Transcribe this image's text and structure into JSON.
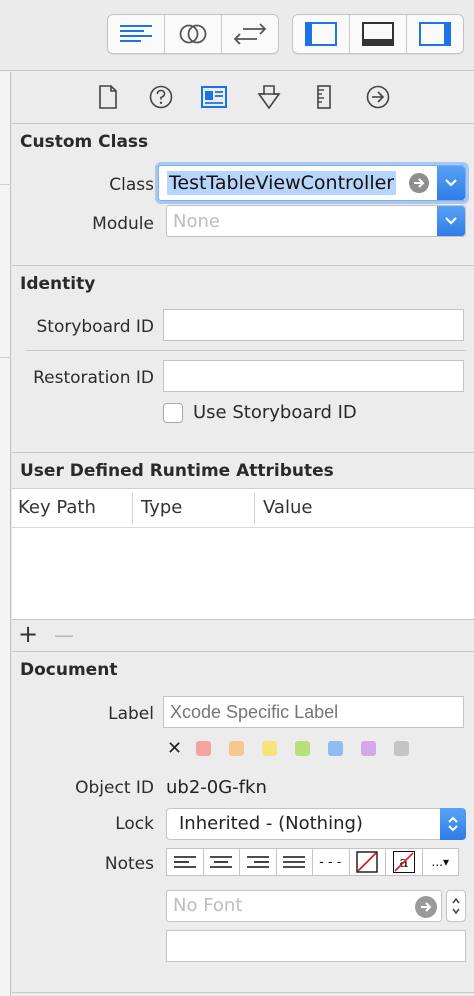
{
  "toolbar": {
    "editor_buttons": [
      {
        "name": "standard-editor-icon",
        "active": true
      },
      {
        "name": "assistant-editor-icon",
        "active": false
      },
      {
        "name": "version-editor-icon",
        "active": false
      }
    ],
    "view_buttons": [
      {
        "name": "navigator-panel-icon",
        "active": true
      },
      {
        "name": "debug-area-icon",
        "active": true
      },
      {
        "name": "utilities-panel-icon",
        "active": true
      }
    ]
  },
  "inspector_tabs": [
    {
      "name": "file-inspector-icon",
      "active": false
    },
    {
      "name": "quick-help-icon",
      "active": false
    },
    {
      "name": "identity-inspector-icon",
      "active": true
    },
    {
      "name": "attributes-inspector-icon",
      "active": false
    },
    {
      "name": "size-inspector-icon",
      "active": false
    },
    {
      "name": "connections-inspector-icon",
      "active": false
    }
  ],
  "custom_class": {
    "title": "Custom Class",
    "class_label": "Class",
    "class_value": "TestTableViewController",
    "module_label": "Module",
    "module_placeholder": "None"
  },
  "identity": {
    "title": "Identity",
    "storyboard_id_label": "Storyboard ID",
    "storyboard_id_value": "",
    "restoration_id_label": "Restoration ID",
    "restoration_id_value": "",
    "use_storyboard_id_label": "Use Storyboard ID",
    "use_storyboard_id_checked": false
  },
  "runtime_attributes": {
    "title": "User Defined Runtime Attributes",
    "columns": [
      "Key Path",
      "Type",
      "Value"
    ],
    "rows": [],
    "add_label": "+",
    "remove_label": "—"
  },
  "document": {
    "title": "Document",
    "label_label": "Label",
    "label_placeholder": "Xcode Specific Label",
    "clear_label": "✕",
    "swatch_colors": [
      "#f4a3a3",
      "#f6c88c",
      "#f5e37d",
      "#b8df7c",
      "#8fbdf3",
      "#d3a9ec",
      "#c5c5c5"
    ],
    "object_id_label": "Object ID",
    "object_id_value": "ub2-0G-fkn",
    "lock_label": "Lock",
    "lock_value": "Inherited - (Nothing)",
    "notes_label": "Notes",
    "notes_tools": [
      {
        "name": "align-left-icon"
      },
      {
        "name": "align-center-icon"
      },
      {
        "name": "align-right-icon"
      },
      {
        "name": "align-justify-icon"
      },
      {
        "name": "line-spacing-icon",
        "text": "---"
      },
      {
        "name": "no-color-icon"
      },
      {
        "name": "text-color-icon",
        "text": "a"
      },
      {
        "name": "more-options-icon",
        "text": "...▾"
      }
    ],
    "font_placeholder": "No Font",
    "notes_value": ""
  },
  "colors": {
    "accent": "#2e7de8",
    "selection": "#b7d4fb",
    "active_icon": "#1b73e8"
  }
}
